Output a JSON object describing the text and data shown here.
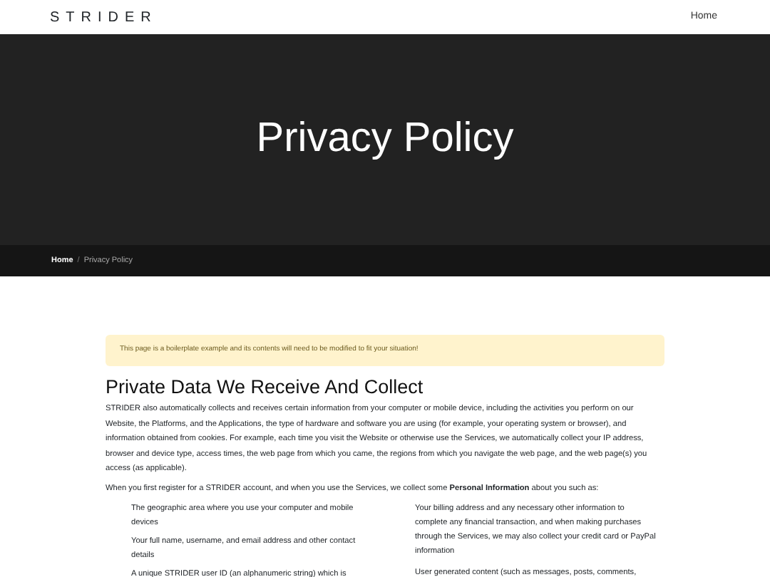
{
  "navbar": {
    "brand": "STRIDER",
    "links": [
      {
        "label": "Home",
        "selected": false
      }
    ]
  },
  "hero": {
    "title": "Privacy Policy"
  },
  "breadcrumb": [
    {
      "label": "Home",
      "selected": false
    },
    {
      "label": "Privacy Policy",
      "selected": true
    }
  ],
  "breadcrumb_separator": "/",
  "alert": "This page is a boilerplate example and its contents will need to be modified to fit your situation!",
  "section": {
    "heading": "Private Data We Receive And Collect",
    "paragraphs": [
      "STRIDER also automatically collects and receives certain information from your computer or mobile device, including the activities you perform on our Website, the Platforms, and the Applications, the type of hardware and software you are using (for example, your operating system or browser), and information obtained from cookies. For example, each time you visit the Website or otherwise use the Services, we automatically collect your IP address, browser and device type, access times, the web page from which you came, the regions from which you navigate the web page, and the web page(s) you access (as applicable).",
      "When you first register for a STRIDER account, and when you use the Services, we collect some **Personal Information** about you such as:"
    ],
    "list_left": [
      "The geographic area where you use your computer and mobile devices",
      "Your full name, username, and email address and other contact details",
      "A unique STRIDER user ID (an alphanumeric string) which is"
    ],
    "list_right": [
      "Your billing address and any necessary other information to complete any financial transaction, and when making purchases through the Services, we may also collect your credit card or PayPal information",
      "User generated content (such as messages, posts, comments,"
    ]
  }
}
